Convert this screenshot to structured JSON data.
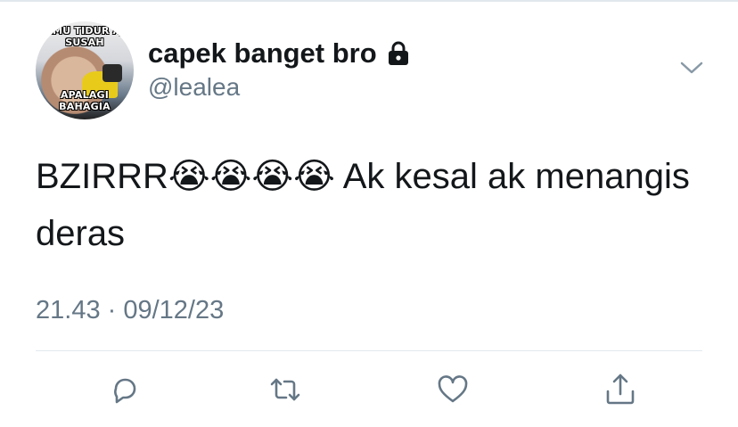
{
  "user": {
    "display_name": "capek banget bro",
    "handle": "@lealea",
    "avatar_caption_top": "KAMU TIDUR AJA SUSAH",
    "avatar_caption_bottom": "APALAGI BAHAGIA"
  },
  "tweet": {
    "text_prefix": "BZIRRR",
    "emojis": "😭😭😭😭",
    "text_suffix": " Ak kesal ak menangis deras"
  },
  "meta": {
    "timestamp": "21.43 · 09/12/23"
  },
  "icons": {
    "lock": "lock-icon",
    "chevron": "chevron-down-icon",
    "reply": "reply-icon",
    "retweet": "retweet-icon",
    "like": "heart-icon",
    "share": "share-icon"
  },
  "colors": {
    "text": "#14171a",
    "secondary": "#657786",
    "divider": "#e1e8ed"
  }
}
